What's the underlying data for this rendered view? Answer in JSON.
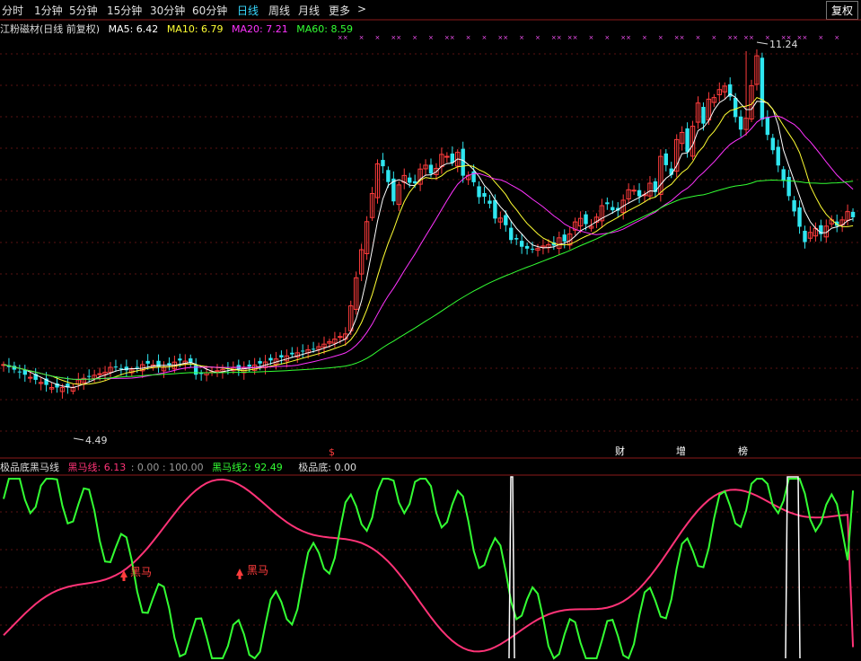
{
  "toolbar": {
    "periods": [
      "分时",
      "1分钟",
      "5分钟",
      "15分钟",
      "30分钟",
      "60分钟",
      "日线",
      "周线",
      "月线",
      "更多"
    ],
    "active": "日线",
    "more_arrow": ">",
    "restore_button": "复权"
  },
  "main_legend": {
    "stock": "江粉磁材(日线 前复权)",
    "ma5": "MA5: 6.42",
    "ma10": "MA10: 6.79",
    "ma20": "MA20: 7.21",
    "ma60": "MA60: 8.59"
  },
  "colors": {
    "up": "#ff3c3c",
    "down": "#2fe6f0",
    "ma5": "#ffffff",
    "ma10": "#ffff33",
    "ma20": "#ff33ff",
    "ma60": "#33ff33",
    "heima": "#ff3377",
    "heima2": "#33ff33",
    "jipindi": "#ffffff"
  },
  "annotations": {
    "high_label": "11.24",
    "low_label": "4.49",
    "markers": [
      "$",
      "财",
      "增",
      "榜"
    ]
  },
  "sub_legend": {
    "name": "极品底黑马线",
    "heima": "黑马线: 6.13",
    "extra": ": 0.00 : 100.00",
    "heima2": "黑马线2: 92.49",
    "jipindi": "极品底: 0.00"
  },
  "sub_signals": [
    "黑马",
    "黑马"
  ],
  "chart_data": [
    {
      "type": "candlestick",
      "series": [
        {
          "name": "MA5",
          "value": 6.42
        },
        {
          "name": "MA10",
          "value": 6.79
        },
        {
          "name": "MA20",
          "value": 7.21
        },
        {
          "name": "MA60",
          "value": 8.59
        }
      ],
      "annotations": {
        "max": 11.24,
        "min": 4.49
      }
    },
    {
      "type": "line",
      "ylim": [
        0,
        100
      ],
      "series": [
        {
          "name": "黑马线",
          "last": 6.13
        },
        {
          "name": "黑马线2",
          "last": 92.49
        },
        {
          "name": "极品底",
          "last": 0.0
        }
      ]
    }
  ]
}
